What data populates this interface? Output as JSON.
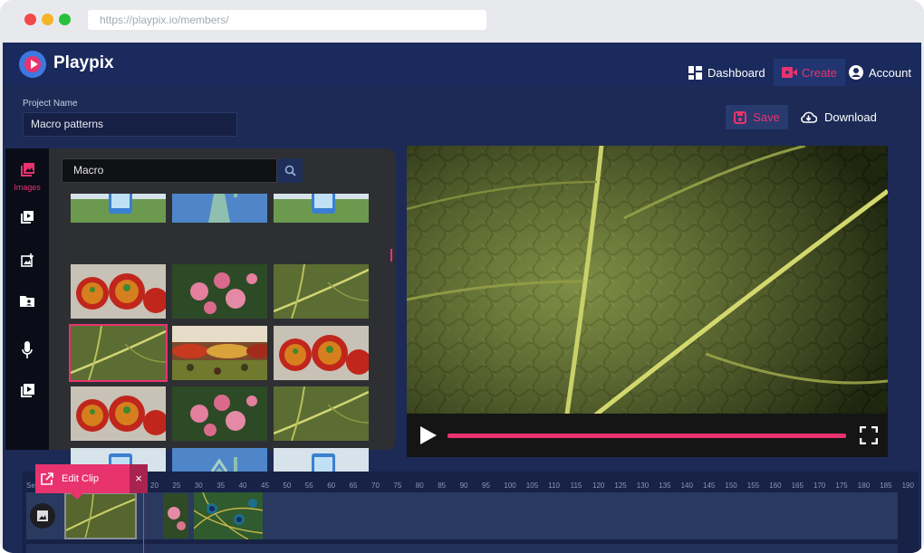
{
  "browser": {
    "url": "https://playpix.io/members/"
  },
  "header": {
    "brand": "Playpix",
    "nav": [
      {
        "label": "Dashboard",
        "icon": "dashboard-icon"
      },
      {
        "label": "Create",
        "icon": "video-camera-icon",
        "active": true
      },
      {
        "label": "Account",
        "icon": "account-icon"
      }
    ]
  },
  "project": {
    "label": "Project Name",
    "value": "Macro patterns",
    "save_label": "Save",
    "download_label": "Download"
  },
  "media_rail": {
    "items": [
      {
        "icon": "images-icon",
        "label": "Images",
        "active": true
      },
      {
        "icon": "video-library-icon",
        "label": ""
      },
      {
        "icon": "add-photo-icon",
        "label": ""
      },
      {
        "icon": "folder-user-icon",
        "label": ""
      },
      {
        "icon": "microphone-icon",
        "label": ""
      },
      {
        "icon": "play-library-icon",
        "label": ""
      }
    ]
  },
  "media_panel": {
    "search_value": "Macro",
    "thumbnails": [
      "phone",
      "statue-of-liberty",
      "phone",
      "soup-bowls",
      "pink-roses",
      "green-leaf",
      "green-leaf",
      "market-spices",
      "soup-bowls",
      "soup-bowls",
      "pink-roses",
      "green-leaf",
      "phone",
      "statue-of-liberty",
      "phone"
    ],
    "selected_index": 6
  },
  "player": {
    "progress": 1.0
  },
  "timeline": {
    "seconds_label": "Second",
    "ticks": [
      "20",
      "25",
      "30",
      "35",
      "40",
      "45",
      "50",
      "55",
      "60",
      "65",
      "70",
      "75",
      "80",
      "85",
      "90",
      "95",
      "100",
      "105",
      "110",
      "115",
      "120",
      "125",
      "130",
      "135",
      "140",
      "145",
      "150",
      "155",
      "160",
      "165",
      "170",
      "175",
      "180",
      "185",
      "190"
    ],
    "edit_clip_label": "Edit Clip",
    "close_label": "×",
    "clips": [
      "green-leaf",
      "pink-roses",
      "peacock-feathers"
    ]
  },
  "colors": {
    "accent": "#e8336f",
    "app_bg": "#1c2a55",
    "rail_bg": "#0a0d18",
    "panel_bg": "#2e2f33"
  }
}
